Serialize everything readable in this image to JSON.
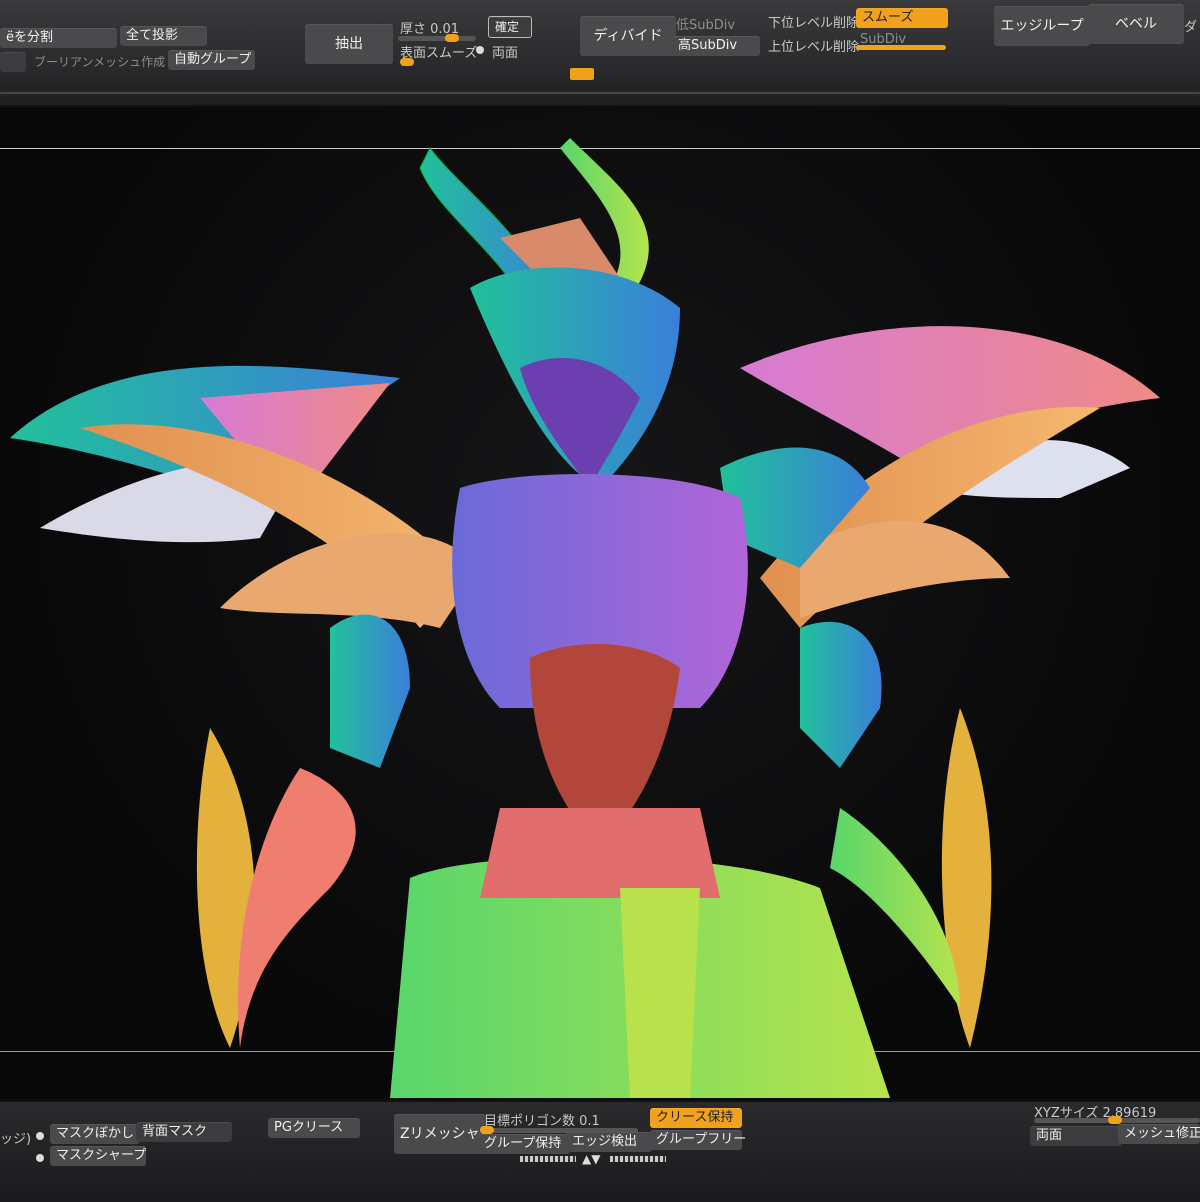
{
  "top": {
    "split_button": "ёを分割",
    "project_all": "全て投影",
    "boolean_label": "ブーリアンメッシュ作成",
    "auto_group": "自動グループ",
    "extract": "抽出",
    "thickness_label": "厚さ 0.01",
    "accept": "確定",
    "surface_smooth": "表面スムーズ",
    "double_sided": "両面",
    "divide": "ディバイド",
    "low_subdiv": "低SubDiv",
    "high_subdiv": "高SubDiv",
    "del_lower": "下位レベル削除",
    "smooth": "スムーズ",
    "del_higher": "上位レベル削除",
    "subdiv_field": "SubDiv",
    "edge_loop": "エッジループ",
    "bevel": "ベベル",
    "cut_off": "ダ"
  },
  "bottom": {
    "edge_partial": "ッジ)",
    "mask_blur": "マスクぼかし",
    "back_mask": "背面マスク",
    "mask_sharpen": "マスクシャープ",
    "pg_crease": "PGクリース",
    "zremesher": "Zリメッシャー",
    "target_polygons": "目標ポリゴン数 0.1",
    "keep_creases": "クリース保持",
    "keep_groups": "グループ保持",
    "detect_edges": "エッジ検出",
    "free_groups": "グループフリー",
    "xyz_size": "XYZサイズ 2.89619",
    "double_sided": "両面",
    "mesh_fix": "メッシュ修正"
  },
  "colors": {
    "accent": "#f2a21a",
    "panel": "#2b2b2d",
    "button": "#4a4a4d"
  }
}
